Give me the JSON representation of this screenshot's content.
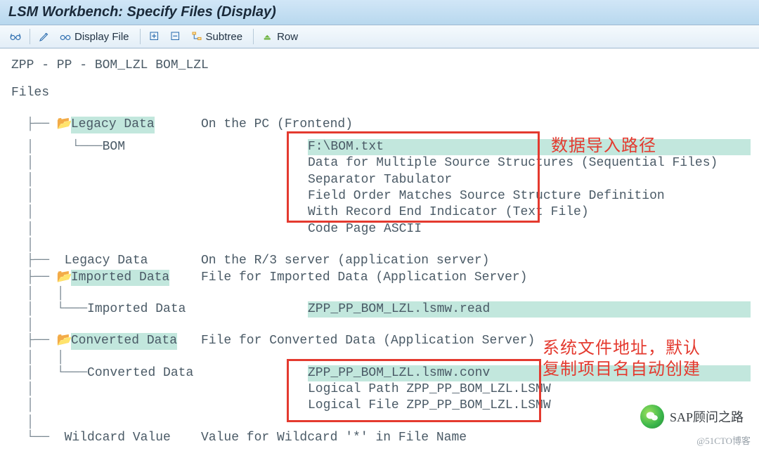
{
  "title": "LSM Workbench: Specify Files (Display)",
  "toolbar": {
    "glasses": "",
    "pencil": "",
    "display_file": "Display File",
    "expand": "",
    "collapse": "",
    "subtree": "Subtree",
    "row": "Row"
  },
  "breadcrumb": "ZPP - PP - BOM_LZL BOM_LZL",
  "tree": {
    "root": "Files",
    "legacy_pc": {
      "label": "Legacy Data",
      "desc": "On the PC (Frontend)"
    },
    "bom": {
      "label": "BOM",
      "path": "F:\\BOM.txt",
      "d1": "Data for Multiple Source Structures (Sequential Files)",
      "d2": "Separator Tabulator",
      "d3": "Field Order Matches Source Structure Definition",
      "d4": "With Record End Indicator (Text File)",
      "d5": "Code Page ASCII"
    },
    "legacy_r3": {
      "label": "Legacy Data",
      "desc": "On the R/3 server (application server)"
    },
    "imported": {
      "label": "Imported Data",
      "desc": "File for Imported Data (Application Server)"
    },
    "imported_child": {
      "label": "Imported Data",
      "val": "ZPP_PP_BOM_LZL.lsmw.read"
    },
    "converted": {
      "label": "Converted Data",
      "desc": "File for Converted Data (Application Server)"
    },
    "converted_child": {
      "label": "Converted Data",
      "val": "ZPP_PP_BOM_LZL.lsmw.conv",
      "lp": "Logical Path ZPP_PP_BOM_LZL.LSMW",
      "lf": "Logical File ZPP_PP_BOM_LZL.LSMW"
    },
    "wildcard": {
      "label": "Wildcard Value",
      "desc": "Value for Wildcard '*' in File Name"
    }
  },
  "annotations": {
    "a1": "数据导入路径",
    "a2_l1": "系统文件地址，默认",
    "a2_l2": "复制项目名自动创建"
  },
  "watermark": {
    "text": "SAP顾问之路"
  },
  "credit": "@51CTO博客"
}
